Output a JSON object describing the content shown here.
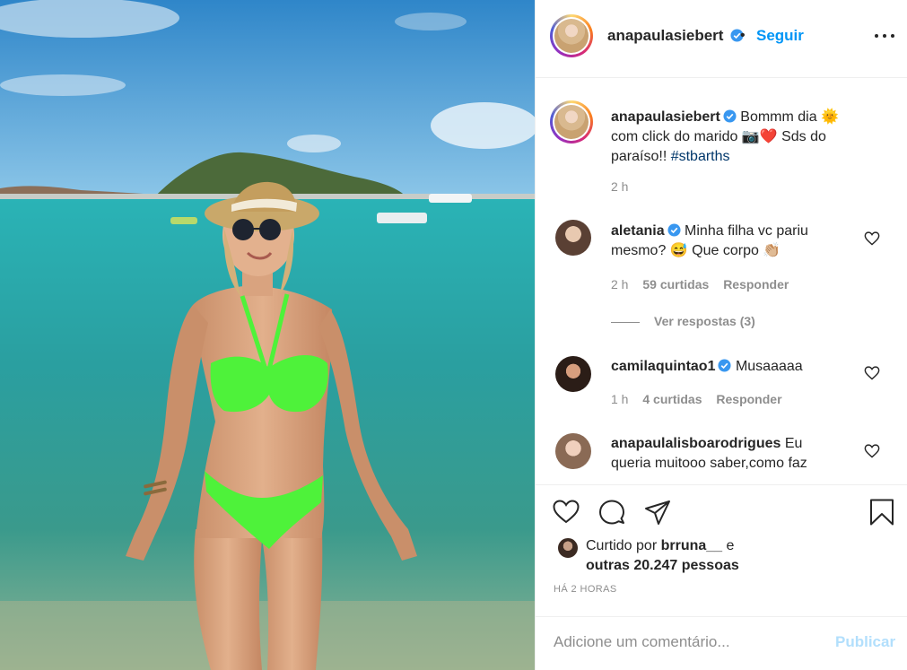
{
  "header": {
    "username": "anapaulasiebert",
    "separator": "•",
    "follow_label": "Seguir"
  },
  "caption": {
    "username": "anapaulasiebert",
    "text_1": "Bommm dia 🌞",
    "text_2": "com click do marido 📷❤️ Sds do",
    "text_3": "paraíso!! ",
    "hashtag": "#stbarths",
    "time": "2 h"
  },
  "comments": [
    {
      "username": "aletania",
      "verified": true,
      "text_1": "Minha filha vc pariu",
      "text_2": "mesmo? 😅 Que corpo 👏🏼",
      "time": "2 h",
      "likes": "59 curtidas",
      "reply": "Responder",
      "view_replies": "Ver respostas (3)"
    },
    {
      "username": "camilaquintao1",
      "verified": true,
      "text_1": "Musaaaaa",
      "time": "1 h",
      "likes": "4 curtidas",
      "reply": "Responder"
    },
    {
      "username": "anapaulalisboarodrigues",
      "verified": false,
      "text_1": "Eu",
      "text_2": "queria muitooo saber,como faz"
    }
  ],
  "actions": {
    "liked_prefix": "Curtido por ",
    "liked_user": "brruna__",
    "liked_and": " e",
    "liked_others": "outras 20.247 pessoas",
    "time_ago": "Há 2 horas"
  },
  "add_comment": {
    "placeholder": "Adicione um comentário...",
    "publish_label": "Publicar"
  },
  "colors": {
    "link_blue": "#0095f6",
    "hashtag": "#00376b",
    "muted": "#8e8e8e",
    "publish_disabled": "#b2dffc",
    "verified": "#3897f0"
  },
  "icons": [
    "heart-icon",
    "comment-icon",
    "share-icon",
    "bookmark-icon",
    "more-options-icon",
    "verified-icon"
  ]
}
